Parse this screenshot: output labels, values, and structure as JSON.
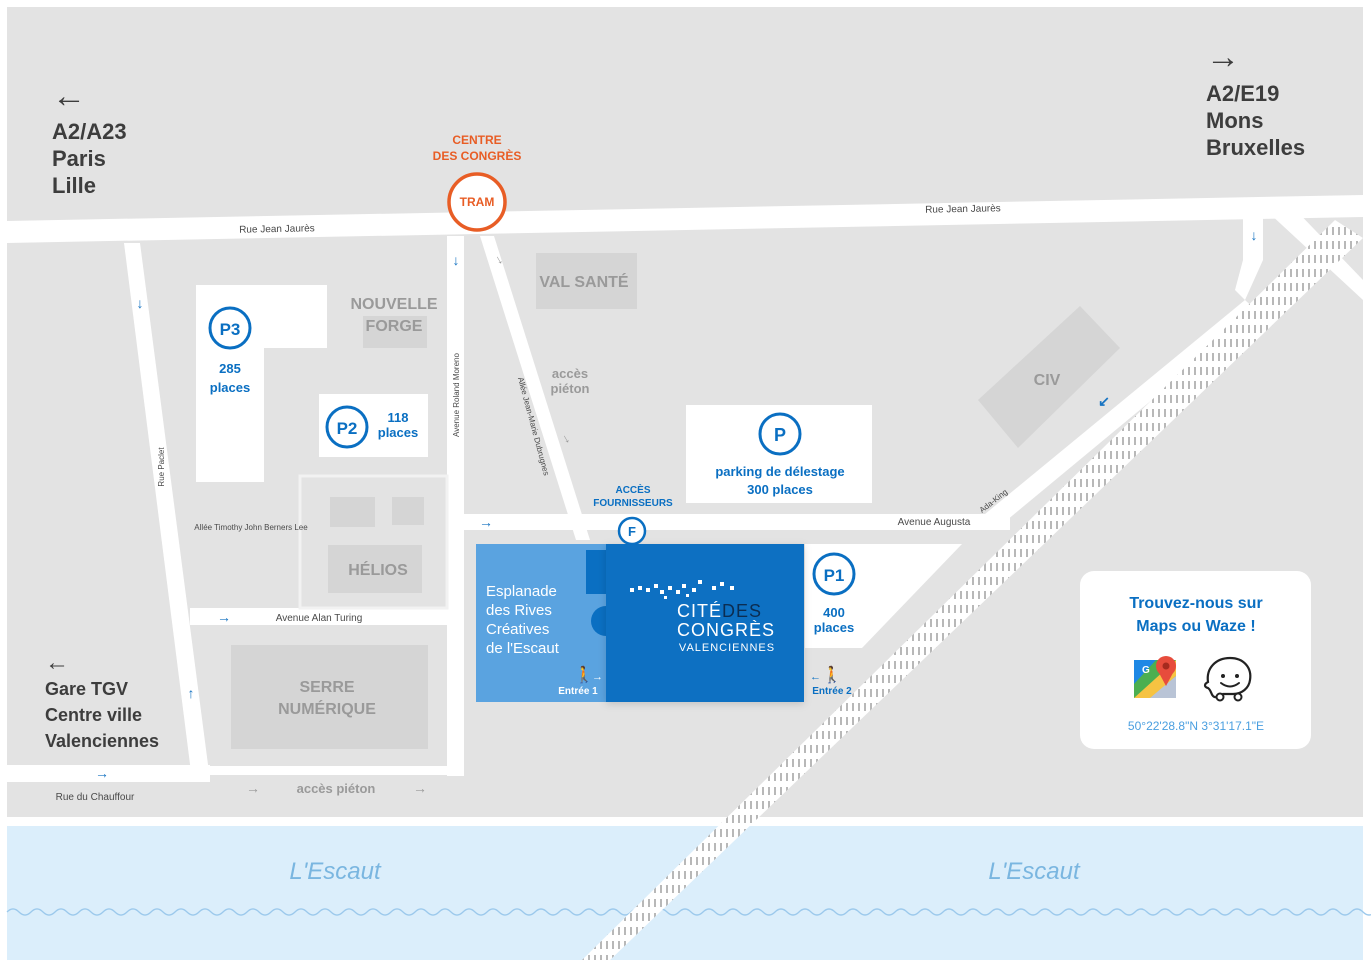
{
  "directions": {
    "left_top": [
      "A2/A23",
      "Paris",
      "Lille"
    ],
    "right_top": [
      "A2/E19",
      "Mons",
      "Bruxelles"
    ],
    "left_bottom": [
      "Gare TGV",
      "Centre ville",
      "Valenciennes"
    ]
  },
  "tram": {
    "station": [
      "CENTRE",
      "DES CONGRÈS"
    ],
    "badge": "TRAM"
  },
  "streets": {
    "jean_jaures_left": "Rue Jean Jaurès",
    "jean_jaures_right": "Rue Jean Jaurès",
    "paclet": "Rue Paclet",
    "roland_moreno": "Avenue Roland Moreno",
    "dubrugnes": "Allée Jean-Marie Dubrugnes",
    "timothy": "Allée Timothy John Berners Lee",
    "alan_turing": "Avenue Alan Turing",
    "augusta": "Avenue Augusta",
    "ada_king": "Ada-King",
    "chauffour": "Rue du Chauffour"
  },
  "buildings": {
    "nouvelle_forge": [
      "NOUVELLE",
      "FORGE"
    ],
    "val_sante": "VAL SANTÉ",
    "civ": "CIV",
    "helios": "HÉLIOS",
    "serre": [
      "SERRE",
      "NUMÉRIQUE"
    ]
  },
  "pedestrian": {
    "north": [
      "accès",
      "piéton"
    ],
    "south": "accès piéton"
  },
  "parkings": {
    "p3": {
      "badge": "P3",
      "count": "285",
      "unit": "places"
    },
    "p2": {
      "badge": "P2",
      "count": "118",
      "unit": "places"
    },
    "p": {
      "badge": "P",
      "name": "parking de délestage",
      "count": "300 places"
    },
    "p1": {
      "badge": "P1",
      "count": "400",
      "unit": "places"
    }
  },
  "fournisseurs": {
    "label": [
      "ACCÈS",
      "FOURNISSEURS"
    ],
    "badge": "F"
  },
  "esplanade": [
    "Esplanade",
    "des Rives",
    "Créatives",
    "de l'Escaut"
  ],
  "entrances": {
    "one": "Entrée 1",
    "two": "Entrée 2"
  },
  "venue": {
    "line1a": "CITÉ",
    "line1b": "DES",
    "line2": "CONGRÈS",
    "line3": "VALENCIENNES"
  },
  "river": {
    "left": "L'Escaut",
    "right": "L'Escaut"
  },
  "card": {
    "title": [
      "Trouvez-nous sur",
      "Maps ou Waze !"
    ],
    "coords": "50°22'28.8\"N 3°31'17.1\"E",
    "icons": [
      "google-maps-icon",
      "waze-icon"
    ]
  },
  "colors": {
    "ground": "#e3e3e3",
    "blocks": "#d5d5d5",
    "brand_blue": "#0a6fc2",
    "light_blue": "#5aa3e0",
    "tram_orange": "#e85d25",
    "river": "#dbeefb"
  }
}
